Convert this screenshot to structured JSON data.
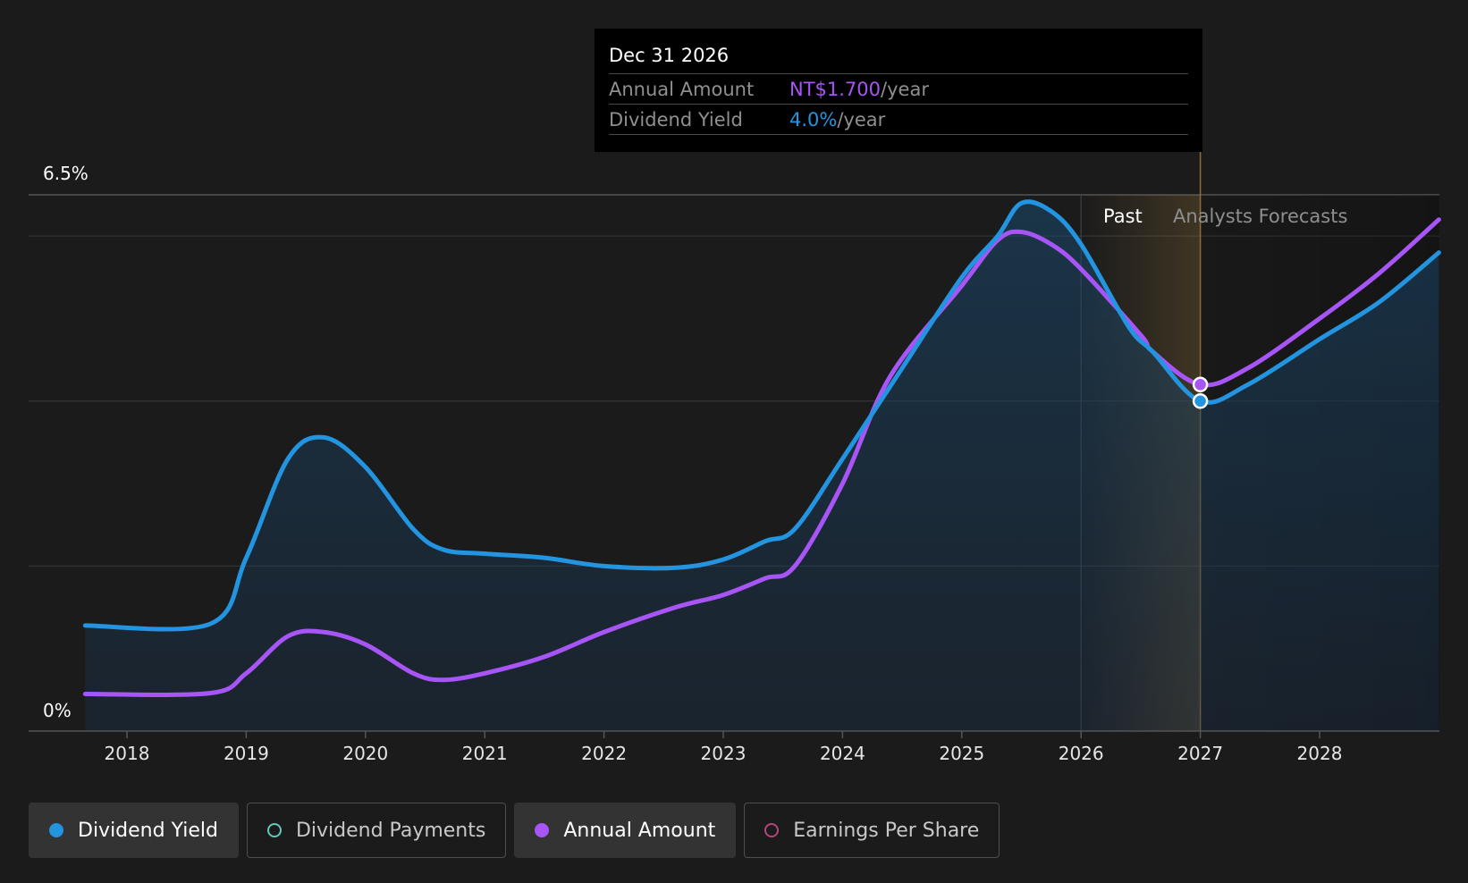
{
  "chart_data": {
    "type": "line",
    "x_ticks": [
      "2018",
      "2019",
      "2020",
      "2021",
      "2022",
      "2023",
      "2024",
      "2025",
      "2026",
      "2027",
      "2028"
    ],
    "y_labels": {
      "top": "6.5%",
      "bottom": "0%"
    },
    "ylim": [
      0,
      6.5
    ],
    "regions": {
      "past_label": "Past",
      "forecast_label": "Analysts Forecasts",
      "past_start": 2026.0,
      "divider": 2027.0
    },
    "series": [
      {
        "name": "Dividend Yield",
        "color": "#2394df",
        "unit": "%",
        "points": [
          [
            2017.65,
            1.28
          ],
          [
            2018.7,
            1.3
          ],
          [
            2019.0,
            2.1
          ],
          [
            2019.35,
            3.3
          ],
          [
            2019.65,
            3.56
          ],
          [
            2020.0,
            3.2
          ],
          [
            2020.4,
            2.45
          ],
          [
            2020.65,
            2.2
          ],
          [
            2021.0,
            2.15
          ],
          [
            2021.5,
            2.1
          ],
          [
            2022.0,
            2.0
          ],
          [
            2022.6,
            1.98
          ],
          [
            2023.0,
            2.08
          ],
          [
            2023.35,
            2.3
          ],
          [
            2023.6,
            2.45
          ],
          [
            2024.0,
            3.3
          ],
          [
            2024.5,
            4.4
          ],
          [
            2025.0,
            5.5
          ],
          [
            2025.3,
            6.0
          ],
          [
            2025.5,
            6.4
          ],
          [
            2025.75,
            6.3
          ],
          [
            2026.0,
            5.9
          ],
          [
            2026.4,
            4.9
          ],
          [
            2026.6,
            4.6
          ],
          [
            2027.0,
            4.0
          ],
          [
            2027.4,
            4.2
          ],
          [
            2028.0,
            4.75
          ],
          [
            2028.5,
            5.2
          ],
          [
            2029.0,
            5.8
          ]
        ]
      },
      {
        "name": "Annual Amount",
        "color": "#a855f7",
        "unit": "NT$",
        "points": [
          [
            2017.65,
            0.45
          ],
          [
            2018.7,
            0.46
          ],
          [
            2019.0,
            0.7
          ],
          [
            2019.35,
            1.15
          ],
          [
            2019.65,
            1.2
          ],
          [
            2020.0,
            1.05
          ],
          [
            2020.4,
            0.7
          ],
          [
            2020.65,
            0.62
          ],
          [
            2021.0,
            0.7
          ],
          [
            2021.5,
            0.9
          ],
          [
            2022.0,
            1.2
          ],
          [
            2022.6,
            1.5
          ],
          [
            2023.0,
            1.65
          ],
          [
            2023.35,
            1.85
          ],
          [
            2023.6,
            2.0
          ],
          [
            2024.0,
            3.0
          ],
          [
            2024.4,
            4.3
          ],
          [
            2025.0,
            5.4
          ],
          [
            2025.3,
            5.95
          ],
          [
            2025.5,
            6.05
          ],
          [
            2025.75,
            5.9
          ],
          [
            2026.0,
            5.6
          ],
          [
            2026.5,
            4.8
          ],
          [
            2026.6,
            4.6
          ],
          [
            2027.0,
            4.2
          ],
          [
            2027.4,
            4.4
          ],
          [
            2028.0,
            5.0
          ],
          [
            2028.5,
            5.55
          ],
          [
            2029.0,
            6.2
          ]
        ]
      }
    ],
    "highlighted_point": {
      "x": 2027.0,
      "annual_y": 4.2,
      "yield_y": 4.0
    }
  },
  "tooltip": {
    "date": "Dec 31 2026",
    "annual_label": "Annual Amount",
    "annual_value": "NT$1.700",
    "annual_unit": "/year",
    "yield_label": "Dividend Yield",
    "yield_value": "4.0%",
    "yield_unit": "/year"
  },
  "legend": [
    {
      "label": "Dividend Yield",
      "active": true,
      "color": "#2394df",
      "filled": true
    },
    {
      "label": "Dividend Payments",
      "active": false,
      "color": "#5fc9b8",
      "filled": false
    },
    {
      "label": "Annual Amount",
      "active": true,
      "color": "#a855f7",
      "filled": true
    },
    {
      "label": "Earnings Per Share",
      "active": false,
      "color": "#b4457a",
      "filled": false
    }
  ]
}
